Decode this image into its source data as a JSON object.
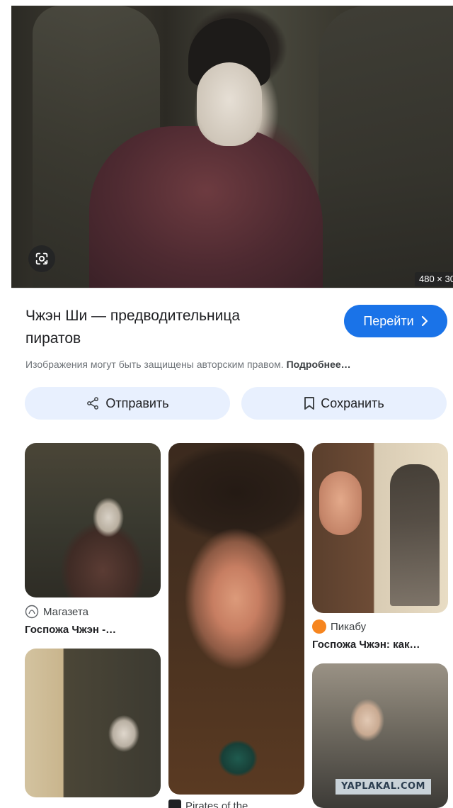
{
  "hero": {
    "dimensions_badge": "480 × 30",
    "lens_icon": "google-lens-icon"
  },
  "result": {
    "title_line1": "Чжэн Ши — предводительница",
    "title_line2": "пиратов",
    "visit_label": "Перейти",
    "visit_icon": "chevron-right-icon",
    "copyright_text": "Изображения могут быть защищены авторским правом.",
    "copyright_link": "Подробнее…"
  },
  "actions": {
    "share_label": "Отправить",
    "share_icon": "share-icon",
    "save_label": "Сохранить",
    "save_icon": "bookmark-icon"
  },
  "related": [
    {
      "source": "Магазета",
      "caption": "Госпожа Чжэн -…",
      "favicon_icon": "magazeta-favicon"
    },
    {
      "source": "Pirates of the",
      "caption": "",
      "favicon_icon": "pirates-favicon"
    },
    {
      "source": "Пикабу",
      "caption": "Госпожа Чжэн: как…",
      "favicon_icon": "pikabu-favicon",
      "favicon_color": "#f6851f"
    }
  ],
  "watermark": "YAPLAKAL.COM",
  "colors": {
    "accent": "#1a73e8",
    "action_bg": "#e8f0fe"
  }
}
